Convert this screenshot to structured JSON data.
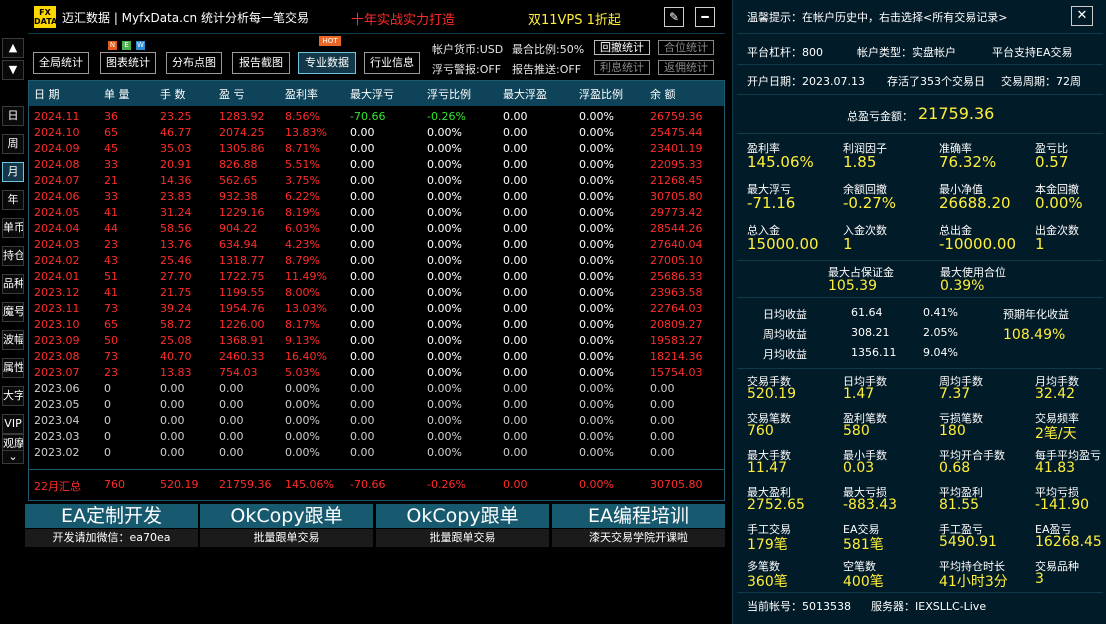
{
  "header": {
    "logo_line1": "FX",
    "logo_line2": "DATA",
    "app_title": "迈汇数据 | MyfxData.cn  统计分析每一笔交易",
    "slogan": "十年实战实力打造",
    "promo": "双11VPS 1折起",
    "edit_icon": "pencil-icon",
    "minimize_icon": "minimize-icon"
  },
  "sidebar": {
    "up": "▲",
    "down": "▼",
    "items": [
      "日",
      "周",
      "月",
      "年",
      "单币",
      "持仓",
      "品种",
      "魔号",
      "波幅",
      "属性",
      "大字",
      "VIP",
      "观摩",
      "⌄"
    ]
  },
  "toolbar": {
    "buttons": [
      "全局统计",
      "图表统计",
      "分布点图",
      "报告截图",
      "专业数据",
      "行业信息"
    ],
    "new_badge": [
      "N",
      "E",
      "W"
    ],
    "hot_badge": "HOT",
    "account_currency": "帐户货币:USD",
    "max_ratio": "最合比例:50%",
    "float_alert": "浮亏警报:OFF",
    "report_push": "报告推送:OFF",
    "stat_buttons": [
      "回撤统计",
      "合位统计",
      "利息统计",
      "返佣统计"
    ]
  },
  "table": {
    "headers": [
      "日 期",
      "单 量",
      "手 数",
      "盈 亏",
      "盈利率",
      "最大浮亏",
      "浮亏比例",
      "最大浮盈",
      "浮盈比例",
      "余 额"
    ],
    "rows": [
      [
        "2024.11",
        "36",
        "23.25",
        "1283.92",
        "8.56%",
        "-70.66",
        "-0.26%",
        "0.00",
        "0.00%",
        "26759.36"
      ],
      [
        "2024.10",
        "65",
        "46.77",
        "2074.25",
        "13.83%",
        "0.00",
        "0.00%",
        "0.00",
        "0.00%",
        "25475.44"
      ],
      [
        "2024.09",
        "45",
        "35.03",
        "1305.86",
        "8.71%",
        "0.00",
        "0.00%",
        "0.00",
        "0.00%",
        "23401.19"
      ],
      [
        "2024.08",
        "33",
        "20.91",
        "826.88",
        "5.51%",
        "0.00",
        "0.00%",
        "0.00",
        "0.00%",
        "22095.33"
      ],
      [
        "2024.07",
        "21",
        "14.36",
        "562.65",
        "3.75%",
        "0.00",
        "0.00%",
        "0.00",
        "0.00%",
        "21268.45"
      ],
      [
        "2024.06",
        "33",
        "23.83",
        "932.38",
        "6.22%",
        "0.00",
        "0.00%",
        "0.00",
        "0.00%",
        "30705.80"
      ],
      [
        "2024.05",
        "41",
        "31.24",
        "1229.16",
        "8.19%",
        "0.00",
        "0.00%",
        "0.00",
        "0.00%",
        "29773.42"
      ],
      [
        "2024.04",
        "44",
        "58.56",
        "904.22",
        "6.03%",
        "0.00",
        "0.00%",
        "0.00",
        "0.00%",
        "28544.26"
      ],
      [
        "2024.03",
        "23",
        "13.76",
        "634.94",
        "4.23%",
        "0.00",
        "0.00%",
        "0.00",
        "0.00%",
        "27640.04"
      ],
      [
        "2024.02",
        "43",
        "25.46",
        "1318.77",
        "8.79%",
        "0.00",
        "0.00%",
        "0.00",
        "0.00%",
        "27005.10"
      ],
      [
        "2024.01",
        "51",
        "27.70",
        "1722.75",
        "11.49%",
        "0.00",
        "0.00%",
        "0.00",
        "0.00%",
        "25686.33"
      ],
      [
        "2023.12",
        "41",
        "21.75",
        "1199.55",
        "8.00%",
        "0.00",
        "0.00%",
        "0.00",
        "0.00%",
        "23963.58"
      ],
      [
        "2023.11",
        "73",
        "39.24",
        "1954.76",
        "13.03%",
        "0.00",
        "0.00%",
        "0.00",
        "0.00%",
        "22764.03"
      ],
      [
        "2023.10",
        "65",
        "58.72",
        "1226.00",
        "8.17%",
        "0.00",
        "0.00%",
        "0.00",
        "0.00%",
        "20809.27"
      ],
      [
        "2023.09",
        "50",
        "25.08",
        "1368.91",
        "9.13%",
        "0.00",
        "0.00%",
        "0.00",
        "0.00%",
        "19583.27"
      ],
      [
        "2023.08",
        "73",
        "40.70",
        "2460.33",
        "16.40%",
        "0.00",
        "0.00%",
        "0.00",
        "0.00%",
        "18214.36"
      ],
      [
        "2023.07",
        "23",
        "13.83",
        "754.03",
        "5.03%",
        "0.00",
        "0.00%",
        "0.00",
        "0.00%",
        "15754.03"
      ],
      [
        "2023.06",
        "0",
        "0.00",
        "0.00",
        "0.00%",
        "0.00",
        "0.00%",
        "0.00",
        "0.00%",
        "0.00"
      ],
      [
        "2023.05",
        "0",
        "0.00",
        "0.00",
        "0.00%",
        "0.00",
        "0.00%",
        "0.00",
        "0.00%",
        "0.00"
      ],
      [
        "2023.04",
        "0",
        "0.00",
        "0.00",
        "0.00%",
        "0.00",
        "0.00%",
        "0.00",
        "0.00%",
        "0.00"
      ],
      [
        "2023.03",
        "0",
        "0.00",
        "0.00",
        "0.00%",
        "0.00",
        "0.00%",
        "0.00",
        "0.00%",
        "0.00"
      ],
      [
        "2023.02",
        "0",
        "0.00",
        "0.00",
        "0.00%",
        "0.00",
        "0.00%",
        "0.00",
        "0.00%",
        "0.00"
      ]
    ],
    "summary": [
      "22月汇总",
      "760",
      "520.19",
      "21759.36",
      "145.06%",
      "-70.66",
      "-0.26%",
      "0.00",
      "0.00%",
      "30705.80"
    ]
  },
  "banners": [
    {
      "title": "EA定制开发",
      "sub": "开发请加微信：ea70ea"
    },
    {
      "title": "OkCopy跟单",
      "sub": "批量跟单交易"
    },
    {
      "title": "OkCopy跟单",
      "sub": "批量跟单交易"
    },
    {
      "title": "EA编程培训",
      "sub": "漆天交易学院开课啦"
    }
  ],
  "right": {
    "tip": "温馨提示：在帐户历史中，右击选择<所有交易记录>",
    "close_icon": "close-icon",
    "leverage": "平台杠杆：800",
    "account_type": "帐户类型：实盘帐户",
    "ea_support": "平台支持EA交易",
    "open_date": "开户日期：2023.07.13",
    "days": "存活了353个交易日",
    "cycle": "交易周期：72周",
    "total_label": "总盈亏金额：",
    "total_value": "21759.36",
    "grid1": [
      [
        "盈利率",
        "145.06%"
      ],
      [
        "利润因子",
        "1.85"
      ],
      [
        "准确率",
        "76.32%"
      ],
      [
        "盈亏比",
        "0.57"
      ],
      [
        "最大浮亏",
        "-71.16"
      ],
      [
        "余额回撤",
        "-0.27%"
      ],
      [
        "最小净值",
        "26688.20"
      ],
      [
        "本金回撤",
        "0.00%"
      ],
      [
        "总入金",
        "15000.00"
      ],
      [
        "入金次数",
        "1"
      ],
      [
        "总出金",
        "-10000.00"
      ],
      [
        "出金次数",
        "1"
      ]
    ],
    "margin_label": "最大占保证金",
    "margin_value": "105.39",
    "pos_label": "最大使用合位",
    "pos_value": "0.39%",
    "income": [
      [
        "日均收益",
        "61.64",
        "0.41%"
      ],
      [
        "周均收益",
        "308.21",
        "2.05%"
      ],
      [
        "月均收益",
        "1356.11",
        "9.04%"
      ]
    ],
    "annual_label": "预期年化收益",
    "annual_value": "108.49%",
    "grid2": [
      [
        "交易手数",
        "520.19"
      ],
      [
        "日均手数",
        "1.47"
      ],
      [
        "周均手数",
        "7.37"
      ],
      [
        "月均手数",
        "32.42"
      ],
      [
        "交易笔数",
        "760"
      ],
      [
        "盈利笔数",
        "580"
      ],
      [
        "亏损笔数",
        "180"
      ],
      [
        "交易频率",
        "2笔/天"
      ],
      [
        "最大手数",
        "11.47"
      ],
      [
        "最小手数",
        "0.03"
      ],
      [
        "平均开合手数",
        "0.68"
      ],
      [
        "每手平均盈亏",
        "41.83"
      ],
      [
        "最大盈利",
        "2752.65"
      ],
      [
        "最大亏损",
        "-883.43"
      ],
      [
        "平均盈利",
        "81.55"
      ],
      [
        "平均亏损",
        "-141.90"
      ],
      [
        "手工交易",
        "179笔"
      ],
      [
        "EA交易",
        "581笔"
      ],
      [
        "手工盈亏",
        "5490.91"
      ],
      [
        "EA盈亏",
        "16268.45"
      ],
      [
        "多笔数",
        "360笔"
      ],
      [
        "空笔数",
        "400笔"
      ],
      [
        "平均持仓时长",
        "41小时3分"
      ],
      [
        "交易品种",
        "3"
      ]
    ],
    "account": "当前帐号：5013538",
    "server": "服务器：IEXSLLC-Live"
  }
}
